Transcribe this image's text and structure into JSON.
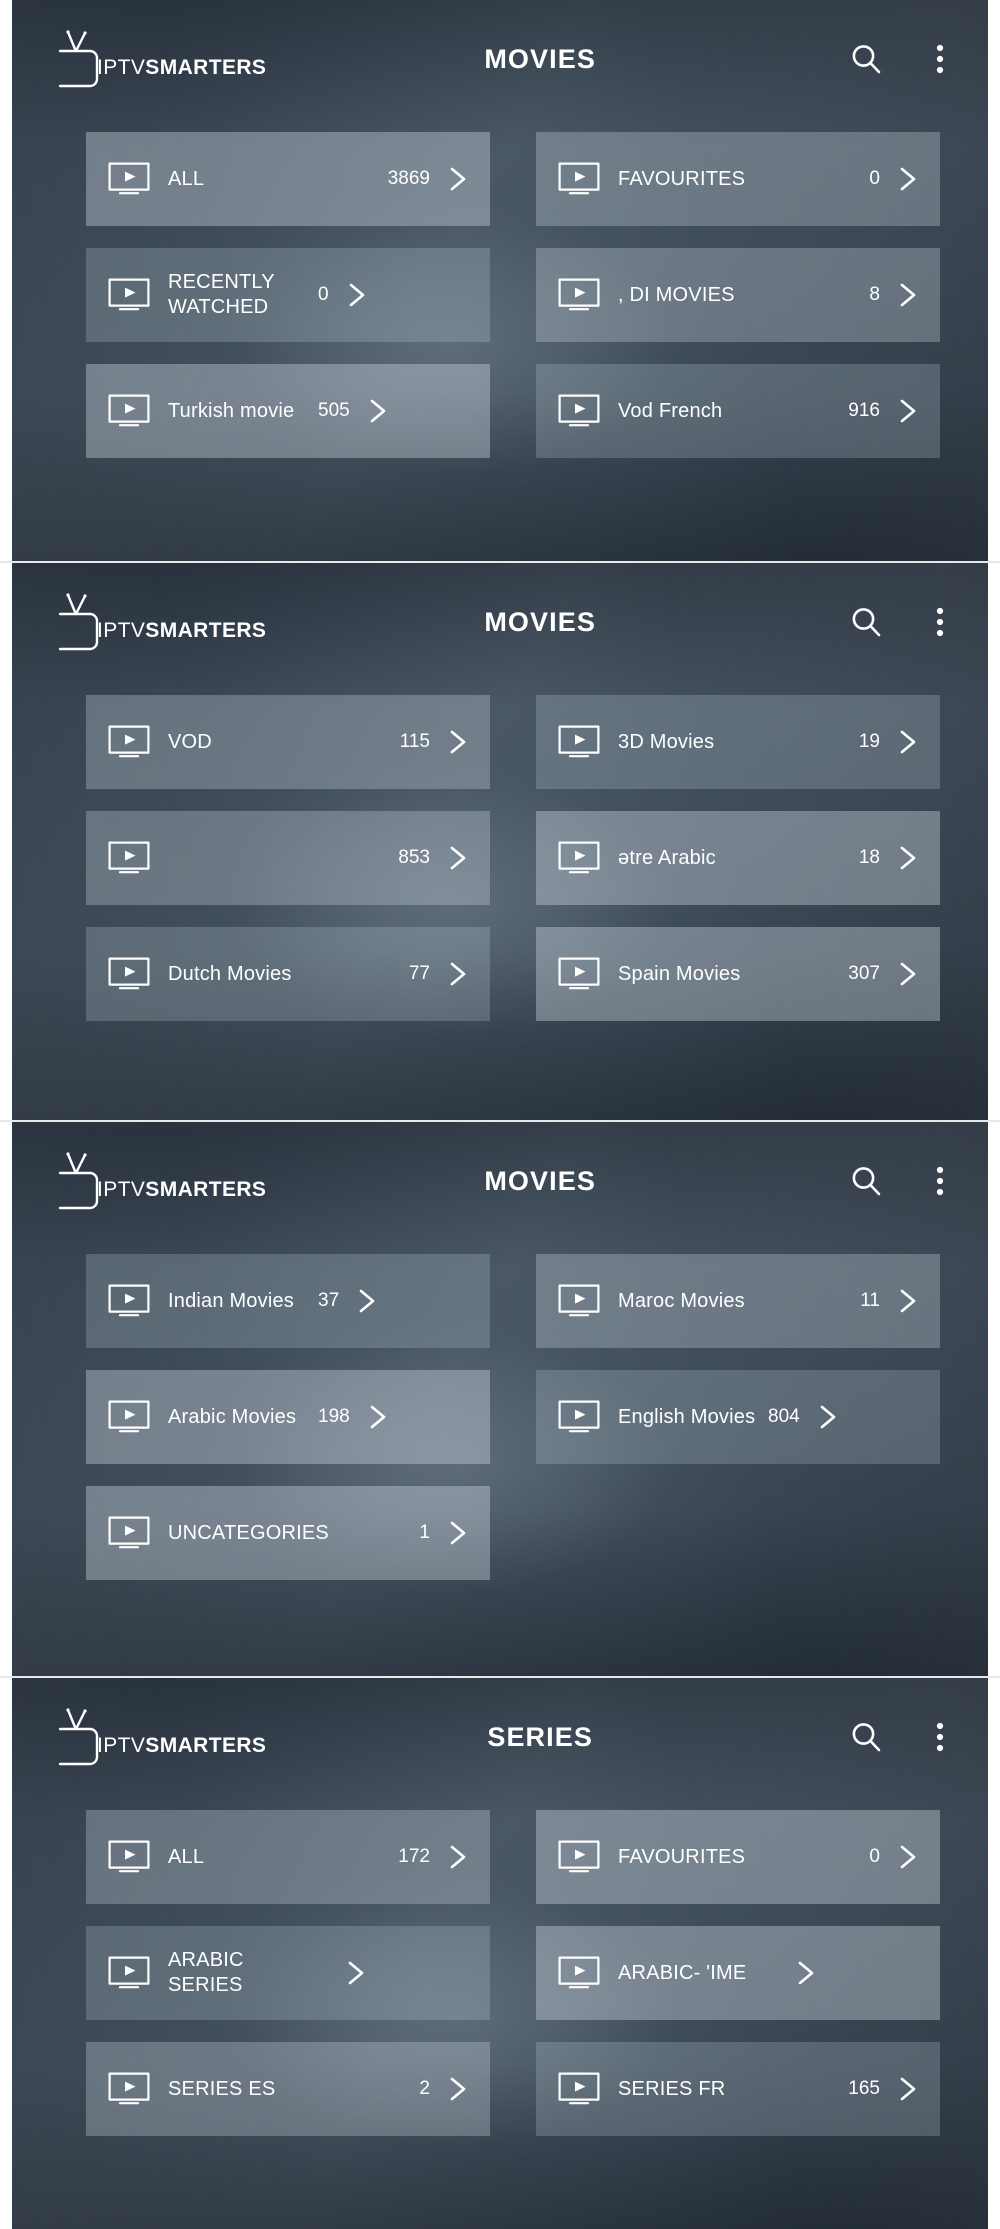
{
  "app": {
    "brand_prefix": "IPTV",
    "brand_suffix": "SMARTERS",
    "accent_card": "#d2dee6",
    "background": "#2e3a47",
    "text_color": "#ffffff"
  },
  "icons": {
    "search": "search-icon",
    "menu": "more-vertical-icon",
    "category": "tv-play-icon",
    "chevron": "chevron-right-icon",
    "logo": "iptv-smarters-logo"
  },
  "screens": [
    {
      "title": "MOVIES",
      "cards": [
        {
          "label": "ALL",
          "count": "3869"
        },
        {
          "label": "FAVOURITES",
          "count": "0"
        },
        {
          "label": "RECENTLY WATCHED",
          "count": "0"
        },
        {
          "label": ",  DI MOVIES",
          "count": "8"
        },
        {
          "label": "Turkish movie",
          "count": "505"
        },
        {
          "label": "Vod French",
          "count": "916"
        }
      ]
    },
    {
      "title": "MOVIES",
      "cards": [
        {
          "label": "VOD",
          "count": "115"
        },
        {
          "label": "3D Movies",
          "count": "19"
        },
        {
          "label": "",
          "count": "853"
        },
        {
          "label": "ətre Arabic",
          "count": "18"
        },
        {
          "label": "Dutch Movies",
          "count": "77"
        },
        {
          "label": "Spain Movies",
          "count": "307"
        }
      ]
    },
    {
      "title": "MOVIES",
      "cards": [
        {
          "label": "Indian Movies",
          "count": "37"
        },
        {
          "label": "Maroc Movies",
          "count": "11"
        },
        {
          "label": "Arabic Movies",
          "count": "198"
        },
        {
          "label": "English Movies",
          "count": "804"
        },
        {
          "label": "UNCATEGORIES",
          "count": "1"
        }
      ]
    },
    {
      "title": "SERIES",
      "cards": [
        {
          "label": "ALL",
          "count": "172"
        },
        {
          "label": "FAVOURITES",
          "count": "0"
        },
        {
          "label": "ARABIC SERIES",
          "count": ""
        },
        {
          "label": "ARABIC-  'IME",
          "count": ""
        },
        {
          "label": "SERIES ES",
          "count": "2"
        },
        {
          "label": "SERIES FR",
          "count": "165"
        }
      ]
    }
  ]
}
